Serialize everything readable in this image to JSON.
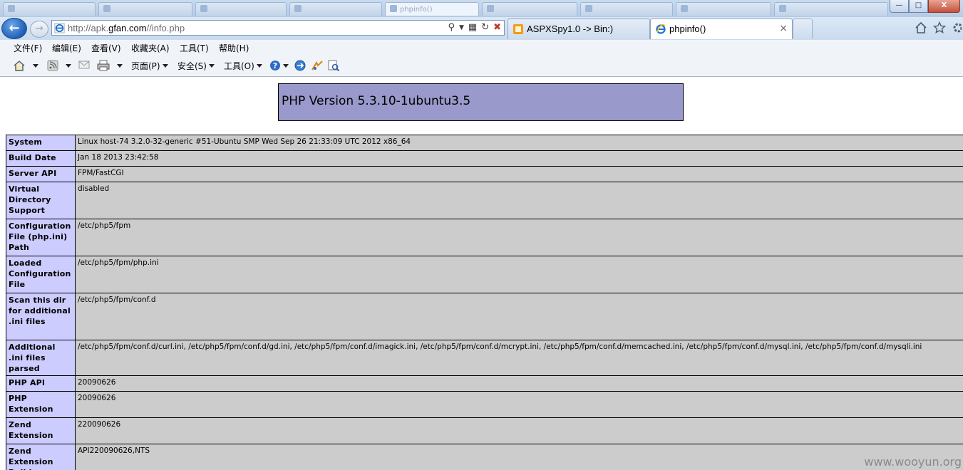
{
  "window": {
    "controls": {
      "minimize": "—",
      "maximize": "□",
      "close": "X"
    },
    "background_tabs": [
      "",
      "",
      "",
      "",
      "phpinfo()",
      "",
      "",
      ""
    ]
  },
  "address_bar": {
    "url_prefix": "http://apk.",
    "url_domain": "gfan.com",
    "url_suffix": "//info.php"
  },
  "tabs": [
    {
      "label": "ASPXSpy1.0 -> Bin:)",
      "icon": "aspxspy-icon"
    },
    {
      "label": "phpinfo()",
      "icon": "ie-page-icon",
      "close": "×"
    }
  ],
  "menu": [
    "文件(F)",
    "编辑(E)",
    "查看(V)",
    "收藏夹(A)",
    "工具(T)",
    "帮助(H)"
  ],
  "command_bar": {
    "page": "页面(P)",
    "safety": "安全(S)",
    "tools": "工具(O)"
  },
  "php": {
    "title": "PHP Version 5.3.10-1ubuntu3.5",
    "rows": [
      {
        "key": "System",
        "value": "Linux host-74 3.2.0-32-generic #51-Ubuntu SMP Wed Sep 26 21:33:09 UTC 2012 x86_64"
      },
      {
        "key": "Build Date",
        "value": "Jan 18 2013 23:42:58"
      },
      {
        "key": "Server API",
        "value": "FPM/FastCGI"
      },
      {
        "key": "Virtual Directory Support",
        "value": "disabled"
      },
      {
        "key": "Configuration File (php.ini) Path",
        "value": "/etc/php5/fpm"
      },
      {
        "key": "Loaded Configuration File",
        "value": "/etc/php5/fpm/php.ini"
      },
      {
        "key": "Scan this dir for additional .ini files",
        "value": "/etc/php5/fpm/conf.d"
      },
      {
        "key": "Additional .ini files parsed",
        "value": "/etc/php5/fpm/conf.d/curl.ini, /etc/php5/fpm/conf.d/gd.ini, /etc/php5/fpm/conf.d/imagick.ini, /etc/php5/fpm/conf.d/mcrypt.ini, /etc/php5/fpm/conf.d/memcached.ini, /etc/php5/fpm/conf.d/mysql.ini, /etc/php5/fpm/conf.d/mysqli.ini"
      },
      {
        "key": "PHP API",
        "value": "20090626"
      },
      {
        "key": "PHP Extension",
        "value": "20090626"
      },
      {
        "key": "Zend Extension",
        "value": "220090626"
      },
      {
        "key": "Zend Extension Build",
        "value": "API220090626,NTS"
      }
    ]
  },
  "watermark": "www.wooyun.org"
}
